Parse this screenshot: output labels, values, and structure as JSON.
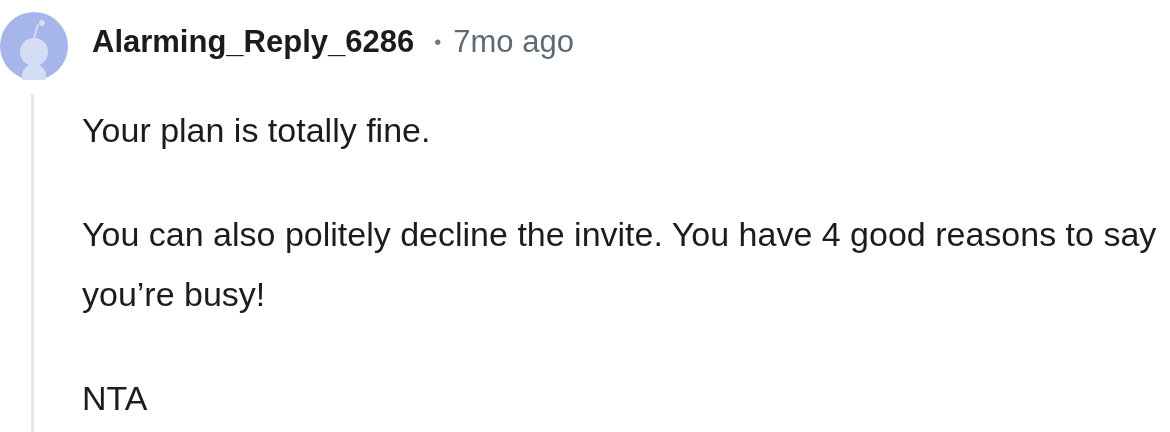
{
  "comment": {
    "author": "Alarming_Reply_6286",
    "separator": "•",
    "age": "7mo ago",
    "paragraphs": [
      "Your plan is totally fine.",
      "You can also politely decline the invite. You have 4 good reasons to say you’re busy!",
      "NTA"
    ]
  }
}
